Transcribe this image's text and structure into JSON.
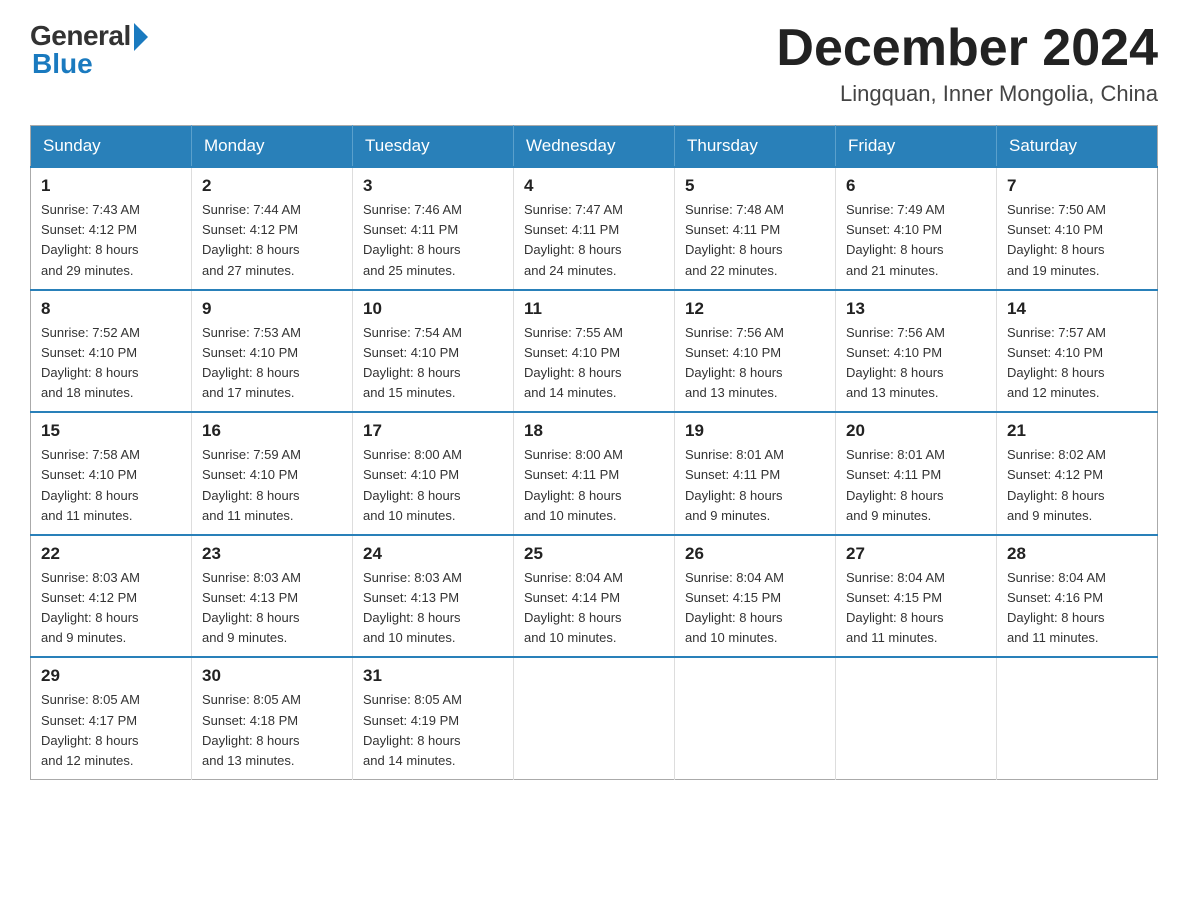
{
  "logo": {
    "general": "General",
    "blue": "Blue"
  },
  "title": "December 2024",
  "location": "Lingquan, Inner Mongolia, China",
  "weekdays": [
    "Sunday",
    "Monday",
    "Tuesday",
    "Wednesday",
    "Thursday",
    "Friday",
    "Saturday"
  ],
  "weeks": [
    [
      {
        "day": "1",
        "sunrise": "7:43 AM",
        "sunset": "4:12 PM",
        "daylight": "8 hours and 29 minutes."
      },
      {
        "day": "2",
        "sunrise": "7:44 AM",
        "sunset": "4:12 PM",
        "daylight": "8 hours and 27 minutes."
      },
      {
        "day": "3",
        "sunrise": "7:46 AM",
        "sunset": "4:11 PM",
        "daylight": "8 hours and 25 minutes."
      },
      {
        "day": "4",
        "sunrise": "7:47 AM",
        "sunset": "4:11 PM",
        "daylight": "8 hours and 24 minutes."
      },
      {
        "day": "5",
        "sunrise": "7:48 AM",
        "sunset": "4:11 PM",
        "daylight": "8 hours and 22 minutes."
      },
      {
        "day": "6",
        "sunrise": "7:49 AM",
        "sunset": "4:10 PM",
        "daylight": "8 hours and 21 minutes."
      },
      {
        "day": "7",
        "sunrise": "7:50 AM",
        "sunset": "4:10 PM",
        "daylight": "8 hours and 19 minutes."
      }
    ],
    [
      {
        "day": "8",
        "sunrise": "7:52 AM",
        "sunset": "4:10 PM",
        "daylight": "8 hours and 18 minutes."
      },
      {
        "day": "9",
        "sunrise": "7:53 AM",
        "sunset": "4:10 PM",
        "daylight": "8 hours and 17 minutes."
      },
      {
        "day": "10",
        "sunrise": "7:54 AM",
        "sunset": "4:10 PM",
        "daylight": "8 hours and 15 minutes."
      },
      {
        "day": "11",
        "sunrise": "7:55 AM",
        "sunset": "4:10 PM",
        "daylight": "8 hours and 14 minutes."
      },
      {
        "day": "12",
        "sunrise": "7:56 AM",
        "sunset": "4:10 PM",
        "daylight": "8 hours and 13 minutes."
      },
      {
        "day": "13",
        "sunrise": "7:56 AM",
        "sunset": "4:10 PM",
        "daylight": "8 hours and 13 minutes."
      },
      {
        "day": "14",
        "sunrise": "7:57 AM",
        "sunset": "4:10 PM",
        "daylight": "8 hours and 12 minutes."
      }
    ],
    [
      {
        "day": "15",
        "sunrise": "7:58 AM",
        "sunset": "4:10 PM",
        "daylight": "8 hours and 11 minutes."
      },
      {
        "day": "16",
        "sunrise": "7:59 AM",
        "sunset": "4:10 PM",
        "daylight": "8 hours and 11 minutes."
      },
      {
        "day": "17",
        "sunrise": "8:00 AM",
        "sunset": "4:10 PM",
        "daylight": "8 hours and 10 minutes."
      },
      {
        "day": "18",
        "sunrise": "8:00 AM",
        "sunset": "4:11 PM",
        "daylight": "8 hours and 10 minutes."
      },
      {
        "day": "19",
        "sunrise": "8:01 AM",
        "sunset": "4:11 PM",
        "daylight": "8 hours and 9 minutes."
      },
      {
        "day": "20",
        "sunrise": "8:01 AM",
        "sunset": "4:11 PM",
        "daylight": "8 hours and 9 minutes."
      },
      {
        "day": "21",
        "sunrise": "8:02 AM",
        "sunset": "4:12 PM",
        "daylight": "8 hours and 9 minutes."
      }
    ],
    [
      {
        "day": "22",
        "sunrise": "8:03 AM",
        "sunset": "4:12 PM",
        "daylight": "8 hours and 9 minutes."
      },
      {
        "day": "23",
        "sunrise": "8:03 AM",
        "sunset": "4:13 PM",
        "daylight": "8 hours and 9 minutes."
      },
      {
        "day": "24",
        "sunrise": "8:03 AM",
        "sunset": "4:13 PM",
        "daylight": "8 hours and 10 minutes."
      },
      {
        "day": "25",
        "sunrise": "8:04 AM",
        "sunset": "4:14 PM",
        "daylight": "8 hours and 10 minutes."
      },
      {
        "day": "26",
        "sunrise": "8:04 AM",
        "sunset": "4:15 PM",
        "daylight": "8 hours and 10 minutes."
      },
      {
        "day": "27",
        "sunrise": "8:04 AM",
        "sunset": "4:15 PM",
        "daylight": "8 hours and 11 minutes."
      },
      {
        "day": "28",
        "sunrise": "8:04 AM",
        "sunset": "4:16 PM",
        "daylight": "8 hours and 11 minutes."
      }
    ],
    [
      {
        "day": "29",
        "sunrise": "8:05 AM",
        "sunset": "4:17 PM",
        "daylight": "8 hours and 12 minutes."
      },
      {
        "day": "30",
        "sunrise": "8:05 AM",
        "sunset": "4:18 PM",
        "daylight": "8 hours and 13 minutes."
      },
      {
        "day": "31",
        "sunrise": "8:05 AM",
        "sunset": "4:19 PM",
        "daylight": "8 hours and 14 minutes."
      },
      null,
      null,
      null,
      null
    ]
  ],
  "labels": {
    "sunrise": "Sunrise: ",
    "sunset": "Sunset: ",
    "daylight": "Daylight: "
  }
}
